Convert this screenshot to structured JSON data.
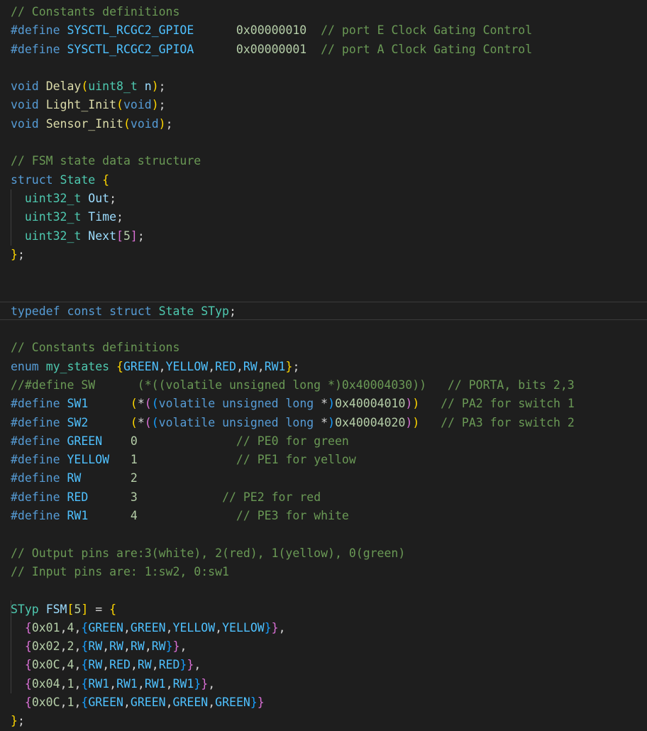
{
  "theme": {
    "background": "#1e1e1e",
    "comment": "#6a9955",
    "keyword": "#569cd6",
    "macro": "#4fc1ff",
    "type": "#4ec9b0",
    "function": "#dcdcaa",
    "variable": "#9cdcfe",
    "number": "#b5cea8",
    "bracket_gold": "#ffd700",
    "bracket_orchid": "#da70d6",
    "bracket_blue": "#179fff"
  },
  "editor": {
    "current_line": 16,
    "indented_lines": [
      10,
      11,
      12,
      32,
      33,
      34,
      35,
      36
    ],
    "lines": [
      [
        [
          "comment",
          "// Constants definitions"
        ]
      ],
      [
        [
          "keyword",
          "#define"
        ],
        [
          "plain",
          " "
        ],
        [
          "macro",
          "SYSCTL_RCGC2_GPIOE"
        ],
        [
          "plain",
          "      "
        ],
        [
          "number",
          "0x00000010"
        ],
        [
          "plain",
          "  "
        ],
        [
          "comment",
          "// port E Clock Gating Control"
        ]
      ],
      [
        [
          "keyword",
          "#define"
        ],
        [
          "plain",
          " "
        ],
        [
          "macro",
          "SYSCTL_RCGC2_GPIOA"
        ],
        [
          "plain",
          "      "
        ],
        [
          "number",
          "0x00000001"
        ],
        [
          "plain",
          "  "
        ],
        [
          "comment",
          "// port A Clock Gating Control"
        ]
      ],
      [],
      [
        [
          "keyword",
          "void"
        ],
        [
          "plain",
          " "
        ],
        [
          "func",
          "Delay"
        ],
        [
          "brace1",
          "("
        ],
        [
          "type",
          "uint8_t"
        ],
        [
          "plain",
          " "
        ],
        [
          "var",
          "n"
        ],
        [
          "brace1",
          ")"
        ],
        [
          "plain",
          ";"
        ]
      ],
      [
        [
          "keyword",
          "void"
        ],
        [
          "plain",
          " "
        ],
        [
          "func",
          "Light_Init"
        ],
        [
          "brace1",
          "("
        ],
        [
          "keyword",
          "void"
        ],
        [
          "brace1",
          ")"
        ],
        [
          "plain",
          ";"
        ]
      ],
      [
        [
          "keyword",
          "void"
        ],
        [
          "plain",
          " "
        ],
        [
          "func",
          "Sensor_Init"
        ],
        [
          "brace1",
          "("
        ],
        [
          "keyword",
          "void"
        ],
        [
          "brace1",
          ")"
        ],
        [
          "plain",
          ";"
        ]
      ],
      [],
      [
        [
          "comment",
          "// FSM state data structure"
        ]
      ],
      [
        [
          "keyword",
          "struct"
        ],
        [
          "plain",
          " "
        ],
        [
          "type",
          "State"
        ],
        [
          "plain",
          " "
        ],
        [
          "brace1",
          "{"
        ]
      ],
      [
        [
          "plain",
          "  "
        ],
        [
          "type",
          "uint32_t"
        ],
        [
          "plain",
          " "
        ],
        [
          "var",
          "Out"
        ],
        [
          "plain",
          ";"
        ]
      ],
      [
        [
          "plain",
          "  "
        ],
        [
          "type",
          "uint32_t"
        ],
        [
          "plain",
          " "
        ],
        [
          "var",
          "Time"
        ],
        [
          "plain",
          ";"
        ]
      ],
      [
        [
          "plain",
          "  "
        ],
        [
          "type",
          "uint32_t"
        ],
        [
          "plain",
          " "
        ],
        [
          "var",
          "Next"
        ],
        [
          "brace2",
          "["
        ],
        [
          "number",
          "5"
        ],
        [
          "brace2",
          "]"
        ],
        [
          "plain",
          ";"
        ]
      ],
      [
        [
          "brace1",
          "}"
        ],
        [
          "plain",
          ";"
        ]
      ],
      [],
      [],
      [
        [
          "keyword",
          "typedef"
        ],
        [
          "plain",
          " "
        ],
        [
          "keyword",
          "const"
        ],
        [
          "plain",
          " "
        ],
        [
          "keyword",
          "struct"
        ],
        [
          "plain",
          " "
        ],
        [
          "type",
          "State"
        ],
        [
          "plain",
          " "
        ],
        [
          "type",
          "STyp"
        ],
        [
          "plain",
          ";"
        ]
      ],
      [],
      [
        [
          "comment",
          "// Constants definitions"
        ]
      ],
      [
        [
          "keyword",
          "enum"
        ],
        [
          "plain",
          " "
        ],
        [
          "type",
          "my_states"
        ],
        [
          "plain",
          " "
        ],
        [
          "brace1",
          "{"
        ],
        [
          "enum",
          "GREEN"
        ],
        [
          "plain",
          ","
        ],
        [
          "enum",
          "YELLOW"
        ],
        [
          "plain",
          ","
        ],
        [
          "enum",
          "RED"
        ],
        [
          "plain",
          ","
        ],
        [
          "enum",
          "RW"
        ],
        [
          "plain",
          ","
        ],
        [
          "enum",
          "RW1"
        ],
        [
          "brace1",
          "}"
        ],
        [
          "plain",
          ";"
        ]
      ],
      [
        [
          "comment",
          "//#define SW      (*((volatile unsigned long *)0x40004030))   // PORTA, bits 2,3"
        ]
      ],
      [
        [
          "keyword",
          "#define"
        ],
        [
          "plain",
          " "
        ],
        [
          "macro",
          "SW1"
        ],
        [
          "plain",
          "      "
        ],
        [
          "brace1",
          "("
        ],
        [
          "plain",
          "*"
        ],
        [
          "brace2",
          "("
        ],
        [
          "brace3",
          "("
        ],
        [
          "keyword",
          "volatile"
        ],
        [
          "plain",
          " "
        ],
        [
          "keyword",
          "unsigned"
        ],
        [
          "plain",
          " "
        ],
        [
          "keyword",
          "long"
        ],
        [
          "plain",
          " *"
        ],
        [
          "brace3",
          ")"
        ],
        [
          "number",
          "0x40004010"
        ],
        [
          "brace2",
          ")"
        ],
        [
          "brace1",
          ")"
        ],
        [
          "plain",
          "   "
        ],
        [
          "comment",
          "// PA2 for switch 1"
        ]
      ],
      [
        [
          "keyword",
          "#define"
        ],
        [
          "plain",
          " "
        ],
        [
          "macro",
          "SW2"
        ],
        [
          "plain",
          "      "
        ],
        [
          "brace1",
          "("
        ],
        [
          "plain",
          "*"
        ],
        [
          "brace2",
          "("
        ],
        [
          "brace3",
          "("
        ],
        [
          "keyword",
          "volatile"
        ],
        [
          "plain",
          " "
        ],
        [
          "keyword",
          "unsigned"
        ],
        [
          "plain",
          " "
        ],
        [
          "keyword",
          "long"
        ],
        [
          "plain",
          " *"
        ],
        [
          "brace3",
          ")"
        ],
        [
          "number",
          "0x40004020"
        ],
        [
          "brace2",
          ")"
        ],
        [
          "brace1",
          ")"
        ],
        [
          "plain",
          "   "
        ],
        [
          "comment",
          "// PA3 for switch 2"
        ]
      ],
      [
        [
          "keyword",
          "#define"
        ],
        [
          "plain",
          " "
        ],
        [
          "macro",
          "GREEN"
        ],
        [
          "plain",
          "    "
        ],
        [
          "number",
          "0"
        ],
        [
          "plain",
          "              "
        ],
        [
          "comment",
          "// PE0 for green"
        ]
      ],
      [
        [
          "keyword",
          "#define"
        ],
        [
          "plain",
          " "
        ],
        [
          "macro",
          "YELLOW"
        ],
        [
          "plain",
          "   "
        ],
        [
          "number",
          "1"
        ],
        [
          "plain",
          "              "
        ],
        [
          "comment",
          "// PE1 for yellow"
        ]
      ],
      [
        [
          "keyword",
          "#define"
        ],
        [
          "plain",
          " "
        ],
        [
          "macro",
          "RW"
        ],
        [
          "plain",
          "       "
        ],
        [
          "number",
          "2"
        ]
      ],
      [
        [
          "keyword",
          "#define"
        ],
        [
          "plain",
          " "
        ],
        [
          "macro",
          "RED"
        ],
        [
          "plain",
          "      "
        ],
        [
          "number",
          "3"
        ],
        [
          "plain",
          "            "
        ],
        [
          "comment",
          "// PE2 for red"
        ]
      ],
      [
        [
          "keyword",
          "#define"
        ],
        [
          "plain",
          " "
        ],
        [
          "macro",
          "RW1"
        ],
        [
          "plain",
          "      "
        ],
        [
          "number",
          "4"
        ],
        [
          "plain",
          "              "
        ],
        [
          "comment",
          "// PE3 for white"
        ]
      ],
      [],
      [
        [
          "comment",
          "// Output pins are:3(white), 2(red), 1(yellow), 0(green)"
        ]
      ],
      [
        [
          "comment",
          "// Input pins are: 1:sw2, 0:sw1"
        ]
      ],
      [],
      [
        [
          "type",
          "STyp"
        ],
        [
          "plain",
          " "
        ],
        [
          "var",
          "FSM"
        ],
        [
          "brace1",
          "["
        ],
        [
          "number",
          "5"
        ],
        [
          "brace1",
          "]"
        ],
        [
          "plain",
          " = "
        ],
        [
          "brace1",
          "{"
        ]
      ],
      [
        [
          "plain",
          "  "
        ],
        [
          "brace2",
          "{"
        ],
        [
          "number",
          "0x01"
        ],
        [
          "plain",
          ","
        ],
        [
          "number",
          "4"
        ],
        [
          "plain",
          ","
        ],
        [
          "brace3",
          "{"
        ],
        [
          "enum",
          "GREEN"
        ],
        [
          "plain",
          ","
        ],
        [
          "enum",
          "GREEN"
        ],
        [
          "plain",
          ","
        ],
        [
          "enum",
          "YELLOW"
        ],
        [
          "plain",
          ","
        ],
        [
          "enum",
          "YELLOW"
        ],
        [
          "brace3",
          "}"
        ],
        [
          "brace2",
          "}"
        ],
        [
          "plain",
          ","
        ]
      ],
      [
        [
          "plain",
          "  "
        ],
        [
          "brace2",
          "{"
        ],
        [
          "number",
          "0x02"
        ],
        [
          "plain",
          ","
        ],
        [
          "number",
          "2"
        ],
        [
          "plain",
          ","
        ],
        [
          "brace3",
          "{"
        ],
        [
          "enum",
          "RW"
        ],
        [
          "plain",
          ","
        ],
        [
          "enum",
          "RW"
        ],
        [
          "plain",
          ","
        ],
        [
          "enum",
          "RW"
        ],
        [
          "plain",
          ","
        ],
        [
          "enum",
          "RW"
        ],
        [
          "brace3",
          "}"
        ],
        [
          "brace2",
          "}"
        ],
        [
          "plain",
          ","
        ]
      ],
      [
        [
          "plain",
          "  "
        ],
        [
          "brace2",
          "{"
        ],
        [
          "number",
          "0x0C"
        ],
        [
          "plain",
          ","
        ],
        [
          "number",
          "4"
        ],
        [
          "plain",
          ","
        ],
        [
          "brace3",
          "{"
        ],
        [
          "enum",
          "RW"
        ],
        [
          "plain",
          ","
        ],
        [
          "enum",
          "RED"
        ],
        [
          "plain",
          ","
        ],
        [
          "enum",
          "RW"
        ],
        [
          "plain",
          ","
        ],
        [
          "enum",
          "RED"
        ],
        [
          "brace3",
          "}"
        ],
        [
          "brace2",
          "}"
        ],
        [
          "plain",
          ","
        ]
      ],
      [
        [
          "plain",
          "  "
        ],
        [
          "brace2",
          "{"
        ],
        [
          "number",
          "0x04"
        ],
        [
          "plain",
          ","
        ],
        [
          "number",
          "1"
        ],
        [
          "plain",
          ","
        ],
        [
          "brace3",
          "{"
        ],
        [
          "enum",
          "RW1"
        ],
        [
          "plain",
          ","
        ],
        [
          "enum",
          "RW1"
        ],
        [
          "plain",
          ","
        ],
        [
          "enum",
          "RW1"
        ],
        [
          "plain",
          ","
        ],
        [
          "enum",
          "RW1"
        ],
        [
          "brace3",
          "}"
        ],
        [
          "brace2",
          "}"
        ],
        [
          "plain",
          ","
        ]
      ],
      [
        [
          "plain",
          "  "
        ],
        [
          "brace2",
          "{"
        ],
        [
          "number",
          "0x0C"
        ],
        [
          "plain",
          ","
        ],
        [
          "number",
          "1"
        ],
        [
          "plain",
          ","
        ],
        [
          "brace3",
          "{"
        ],
        [
          "enum",
          "GREEN"
        ],
        [
          "plain",
          ","
        ],
        [
          "enum",
          "GREEN"
        ],
        [
          "plain",
          ","
        ],
        [
          "enum",
          "GREEN"
        ],
        [
          "plain",
          ","
        ],
        [
          "enum",
          "GREEN"
        ],
        [
          "brace3",
          "}"
        ],
        [
          "brace2",
          "}"
        ]
      ],
      [
        [
          "brace1",
          "}"
        ],
        [
          "plain",
          ";"
        ]
      ]
    ]
  }
}
